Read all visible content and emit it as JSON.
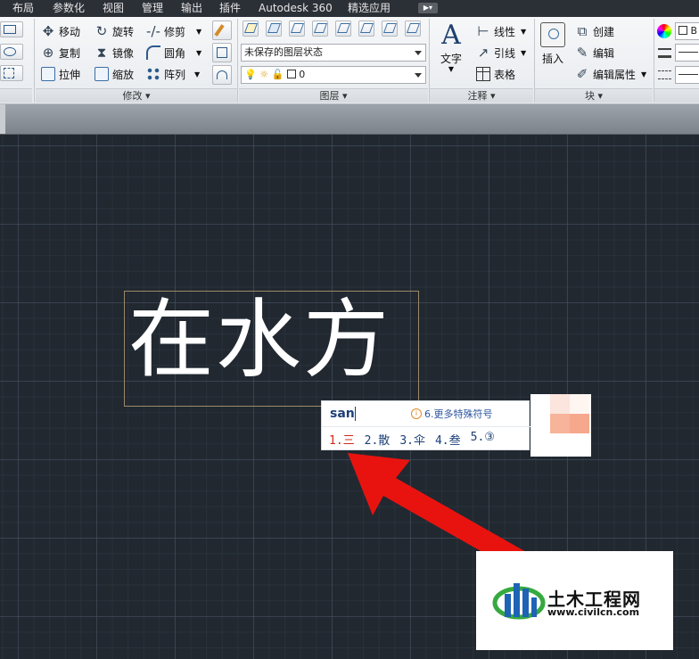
{
  "menu": {
    "items": [
      "布局",
      "参数化",
      "视图",
      "管理",
      "输出",
      "插件",
      "Autodesk 360",
      "精选应用"
    ],
    "extra_icon": "video-icon"
  },
  "ribbon": {
    "modify": {
      "title": "修改",
      "tools": [
        "移动",
        "旋转",
        "修剪",
        "复制",
        "镜像",
        "圆角",
        "拉伸",
        "缩放",
        "阵列"
      ]
    },
    "layers": {
      "title": "图层",
      "state_combo": "未保存的图层状态",
      "layer_combo": "0"
    },
    "annotation": {
      "title": "注释",
      "text_label": "文字",
      "tools": [
        "线性",
        "引线",
        "表格"
      ]
    },
    "block": {
      "title": "块",
      "insert_label": "插入",
      "tools": [
        "创建",
        "编辑",
        "编辑属性"
      ]
    },
    "properties": {
      "color_value": "B"
    }
  },
  "drawing": {
    "mtext": "在水方"
  },
  "ime": {
    "input": "san",
    "more_symbols": "6.更多特殊符号",
    "candidates": [
      "1.三",
      "2.散",
      "3.伞",
      "4.叁",
      "5.③"
    ]
  },
  "watermark": {
    "name": "土木工程网",
    "url": "www.civilcn.com"
  },
  "colors": {
    "arrow": "#e8130f",
    "canvas_bg": "#212830",
    "ime_selected": "#d0281e",
    "logo_blue": "#1e63b5",
    "logo_green": "#36a93f"
  }
}
